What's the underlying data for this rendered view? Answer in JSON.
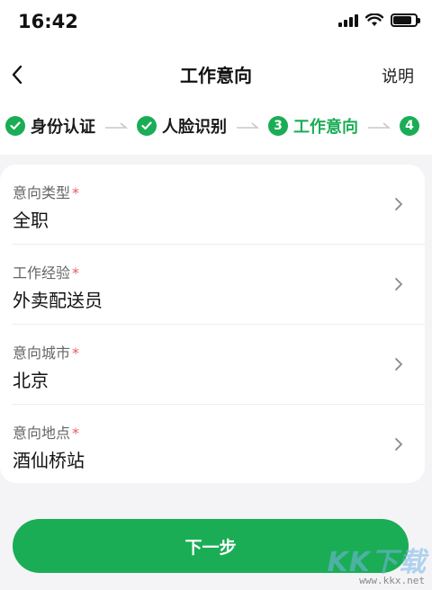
{
  "status_bar": {
    "time": "16:42"
  },
  "nav": {
    "title": "工作意向",
    "help_label": "说明"
  },
  "steps": [
    {
      "label": "身份认证",
      "state": "done"
    },
    {
      "label": "人脸识别",
      "state": "done"
    },
    {
      "number": "3",
      "label": "工作意向",
      "state": "active"
    },
    {
      "number": "4",
      "label": "",
      "state": "pending"
    }
  ],
  "form": {
    "fields": [
      {
        "label": "意向类型",
        "required_mark": "*",
        "value": "全职"
      },
      {
        "label": "工作经验",
        "required_mark": "*",
        "value": "外卖配送员"
      },
      {
        "label": "意向城市",
        "required_mark": "*",
        "value": "北京"
      },
      {
        "label": "意向地点",
        "required_mark": "*",
        "value": "酒仙桥站"
      }
    ]
  },
  "next_button_label": "下一步",
  "watermark": {
    "text": "KK下载",
    "url": "www.kkx.net"
  },
  "colors": {
    "accent": "#1aad55",
    "required": "#ee5a5a",
    "background": "#f4f4f6"
  }
}
